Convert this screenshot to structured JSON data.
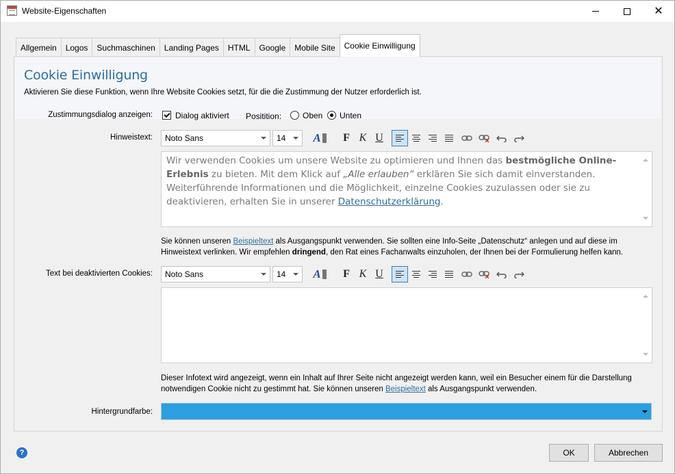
{
  "window": {
    "title": "Website-Eigenschaften"
  },
  "tabs": [
    {
      "label": "Allgemein"
    },
    {
      "label": "Logos"
    },
    {
      "label": "Suchmaschinen"
    },
    {
      "label": "Landing Pages"
    },
    {
      "label": "HTML"
    },
    {
      "label": "Google"
    },
    {
      "label": "Mobile Site"
    },
    {
      "label": "Cookie Einwilligung",
      "active": true
    }
  ],
  "section": {
    "heading": "Cookie Einwilligung",
    "intro": "Aktivieren Sie diese Funktion, wenn Ihre Website Cookies setzt, für die die Zustimmung der Nutzer erforderlich ist."
  },
  "dialog": {
    "label": "Zustimmungsdialog anzeigen:",
    "checkbox_label": "Dialog aktiviert",
    "checked": true,
    "position_label": "Positition:",
    "position_options": [
      "Oben",
      "Unten"
    ],
    "position_selected": "Unten"
  },
  "hint": {
    "label": "Hinweistext:",
    "font": "Noto Sans",
    "size": "14",
    "text_part1": "Wir verwenden Cookies um unsere Website zu optimieren und Ihnen das ",
    "text_bold": "bestmögliche Online-Erlebnis",
    "text_part2": " zu bieten. Mit dem Klick auf ",
    "text_italic": "„Alle erlauben“",
    "text_part3": " erklären Sie sich damit einverstanden. Weiterführende Informationen und die Möglichkeit, einzelne Cookies zuzulassen oder sie zu deaktivieren, erhalten Sie in unserer ",
    "text_link": "Datenschutzerklärung",
    "text_end": ".",
    "note_part1": "Sie können unseren ",
    "note_link": "Beispieltext",
    "note_part2": " als Ausgangspunkt verwenden. Sie sollten eine Info-Seite „Datenschutz“ anlegen und auf diese im Hinweistext verlinken. Wir empfehlen ",
    "note_bold": "dringend",
    "note_part3": ", den Rat eines Fachanwalts einzuholen, der Ihnen bei der Formulierung helfen kann."
  },
  "disabled_text": {
    "label": "Text bei deaktivierten Cookies:",
    "font": "Noto Sans",
    "size": "14",
    "note_part1": "Dieser Infotext wird angezeigt, wenn ein Inhalt auf Ihrer Seite nicht angezeigt werden kann, weil ein Besucher einem für die Darstellung notwendigen Cookie nicht zu gestimmt hat. Sie können unseren ",
    "note_link": "Beispieltext",
    "note_part2": " als Ausgangspunkt verwenden."
  },
  "background": {
    "label": "Hintergrundfarbe:",
    "color": "#2b9fe0"
  },
  "buttons": {
    "ok": "OK",
    "cancel": "Abbrechen"
  },
  "icons": [
    "app-icon",
    "minimize-icon",
    "maximize-icon",
    "close-icon",
    "font-color-icon",
    "bold-icon",
    "italic-icon",
    "underline-icon",
    "align-left-icon",
    "align-center-icon",
    "align-right-icon",
    "align-justify-icon",
    "link-icon",
    "unlink-icon",
    "undo-icon",
    "redo-icon",
    "help-icon"
  ]
}
